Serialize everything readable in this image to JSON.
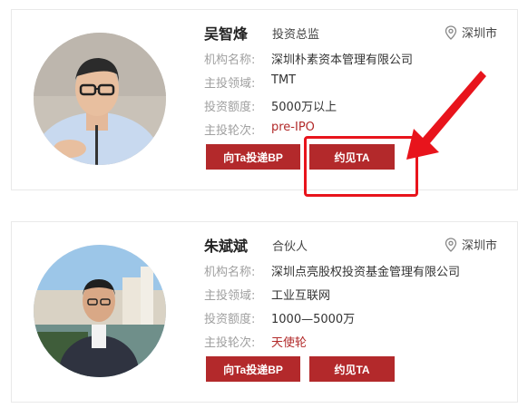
{
  "cards": [
    {
      "name": "吴智烽",
      "title": "投资总监",
      "location": "深圳市",
      "location_icon": "location-pin-icon",
      "rows": [
        {
          "label": "机构名称:",
          "value": "深圳朴素资本管理有限公司"
        },
        {
          "label": "主投领域:",
          "value": "TMT"
        },
        {
          "label": "投资额度:",
          "value": "5000万以上"
        },
        {
          "label": "主投轮次:",
          "value": "pre-IPO"
        }
      ],
      "buttons": {
        "pitch": "向Ta投递BP",
        "meet": "约见TA"
      }
    },
    {
      "name": "朱斌斌",
      "title": "合伙人",
      "location": "深圳市",
      "location_icon": "location-pin-icon",
      "rows": [
        {
          "label": "机构名称:",
          "value": "深圳点亮股权投资基金管理有限公司"
        },
        {
          "label": "主投领域:",
          "value": "工业互联网"
        },
        {
          "label": "投资额度:",
          "value": "1000—5000万"
        },
        {
          "label": "主投轮次:",
          "value": "天使轮"
        }
      ],
      "buttons": {
        "pitch": "向Ta投递BP",
        "meet": "约见TA"
      }
    }
  ],
  "colors": {
    "accent": "#b3292b",
    "annotation": "#e8141c",
    "label": "#a0a0a0"
  }
}
